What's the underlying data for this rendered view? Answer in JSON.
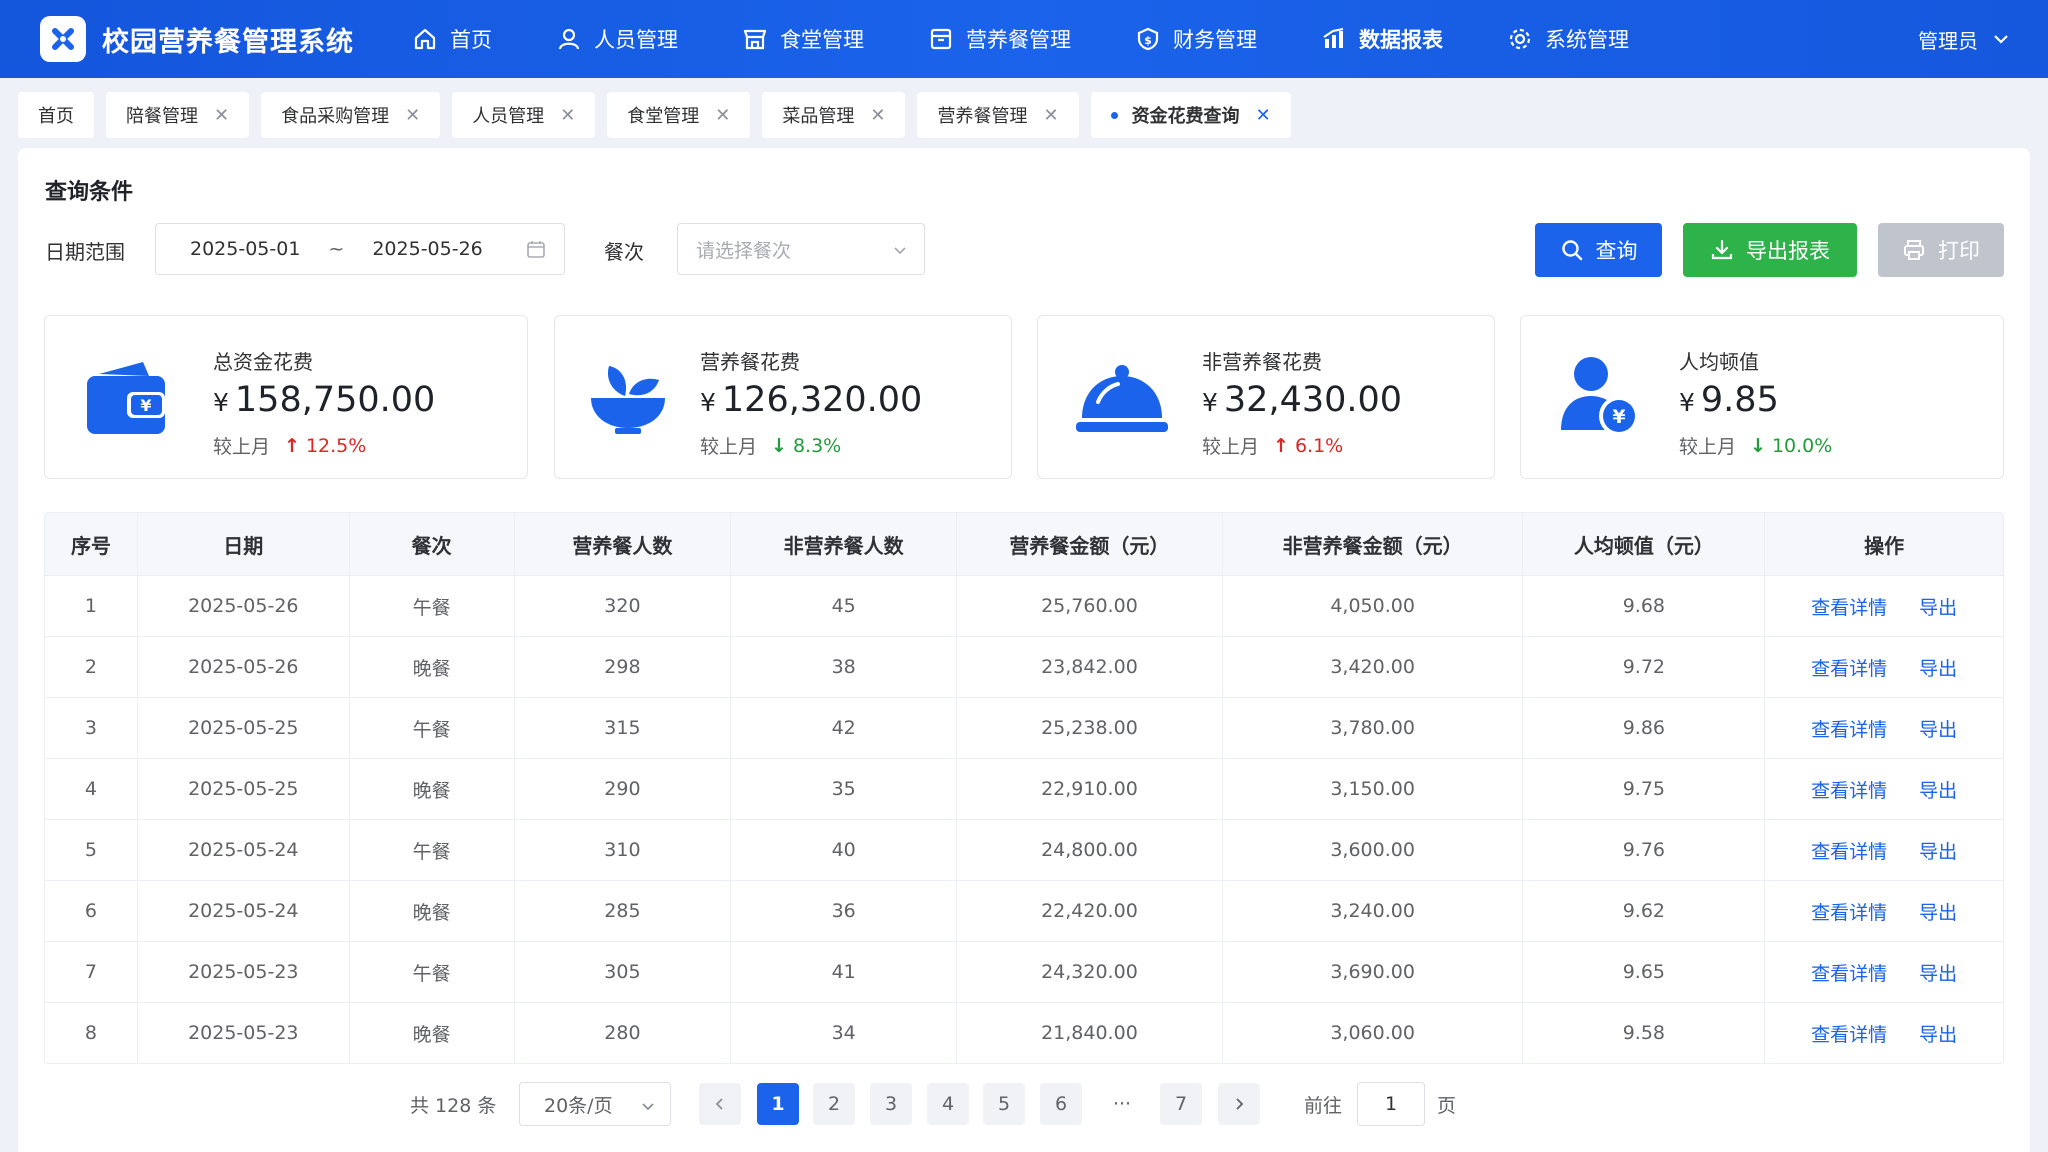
{
  "app": {
    "title": "校园营养餐管理系统",
    "brand_color": "#1a63ea"
  },
  "nav": {
    "items": [
      {
        "label": "首页",
        "icon": "home-icon"
      },
      {
        "label": "人员管理",
        "icon": "user-icon"
      },
      {
        "label": "食堂管理",
        "icon": "canteen-icon"
      },
      {
        "label": "营养餐管理",
        "icon": "meal-box-icon"
      },
      {
        "label": "财务管理",
        "icon": "finance-icon"
      },
      {
        "label": "数据报表",
        "icon": "bar-chart-icon",
        "active": true
      },
      {
        "label": "系统管理",
        "icon": "gear-icon"
      }
    ],
    "user": "管理员"
  },
  "tabs": [
    {
      "label": "首页",
      "closable": false
    },
    {
      "label": "陪餐管理",
      "closable": true
    },
    {
      "label": "食品采购管理",
      "closable": true
    },
    {
      "label": "人员管理",
      "closable": true
    },
    {
      "label": "食堂管理",
      "closable": true
    },
    {
      "label": "菜品管理",
      "closable": true
    },
    {
      "label": "营养餐管理",
      "closable": true
    },
    {
      "label": "资金花费查询",
      "closable": true,
      "active": true
    }
  ],
  "query": {
    "section_title": "查询条件",
    "date_label": "日期范围",
    "date_start": "2025-05-01",
    "date_sep": "~",
    "date_end": "2025-05-26",
    "meal_label": "餐次",
    "meal_placeholder": "请选择餐次",
    "btn_query": "查询",
    "btn_export": "导出报表",
    "btn_print": "打印"
  },
  "stats": [
    {
      "label": "总资金花费",
      "currency": "¥",
      "value": "158,750.00",
      "compare_label": "较上月",
      "trend": "up",
      "change": "12.5%",
      "icon": "wallet-icon"
    },
    {
      "label": "营养餐花费",
      "currency": "¥",
      "value": "126,320.00",
      "compare_label": "较上月",
      "trend": "down",
      "change": "8.3%",
      "icon": "bowl-sprout-icon"
    },
    {
      "label": "非营养餐花费",
      "currency": "¥",
      "value": "32,430.00",
      "compare_label": "较上月",
      "trend": "up",
      "change": "6.1%",
      "icon": "food-cloche-icon"
    },
    {
      "label": "人均顿值",
      "currency": "¥",
      "value": "9.85",
      "compare_label": "较上月",
      "trend": "down",
      "change": "10.0%",
      "icon": "user-yen-icon"
    }
  ],
  "table": {
    "columns": [
      "序号",
      "日期",
      "餐次",
      "营养餐人数",
      "非营养餐人数",
      "营养餐金额（元）",
      "非营养餐金额（元）",
      "人均顿值（元）",
      "操作"
    ],
    "action_view": "查看详情",
    "action_export": "导出",
    "rows": [
      [
        "1",
        "2025-05-26",
        "午餐",
        "320",
        "45",
        "25,760.00",
        "4,050.00",
        "9.68"
      ],
      [
        "2",
        "2025-05-26",
        "晚餐",
        "298",
        "38",
        "23,842.00",
        "3,420.00",
        "9.72"
      ],
      [
        "3",
        "2025-05-25",
        "午餐",
        "315",
        "42",
        "25,238.00",
        "3,780.00",
        "9.86"
      ],
      [
        "4",
        "2025-05-25",
        "晚餐",
        "290",
        "35",
        "22,910.00",
        "3,150.00",
        "9.75"
      ],
      [
        "5",
        "2025-05-24",
        "午餐",
        "310",
        "40",
        "24,800.00",
        "3,600.00",
        "9.76"
      ],
      [
        "6",
        "2025-05-24",
        "晚餐",
        "285",
        "36",
        "22,420.00",
        "3,240.00",
        "9.62"
      ],
      [
        "7",
        "2025-05-23",
        "午餐",
        "305",
        "41",
        "24,320.00",
        "3,690.00",
        "9.65"
      ],
      [
        "8",
        "2025-05-23",
        "晚餐",
        "280",
        "34",
        "21,840.00",
        "3,060.00",
        "9.58"
      ]
    ]
  },
  "pagination": {
    "total": "共 128 条",
    "page_size": "20条/页",
    "pages": [
      "1",
      "2",
      "3",
      "4",
      "5",
      "6",
      "7"
    ],
    "current": "1",
    "ellipsis": "···",
    "goto_label": "前往",
    "goto_value": "1",
    "page_label": "页"
  }
}
